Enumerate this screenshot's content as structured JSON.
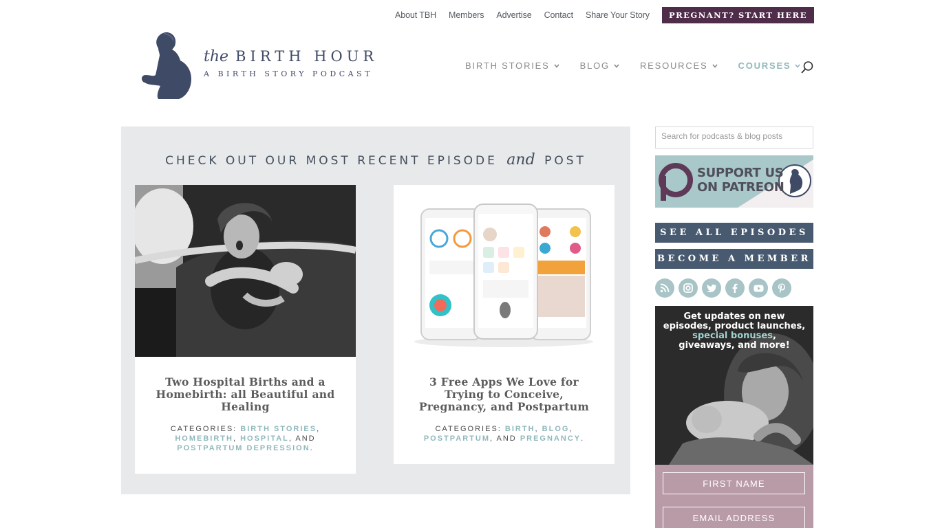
{
  "topnav": {
    "links": [
      "About TBH",
      "Members",
      "Advertise",
      "Contact",
      "Share Your Story"
    ],
    "cta": "PREGNANT? START HERE"
  },
  "logo": {
    "the": "the",
    "name": "BIRTH HOUR",
    "tagline": "A BIRTH STORY PODCAST"
  },
  "mainnav": {
    "items": [
      "BIRTH STORIES",
      "BLOG",
      "RESOURCES",
      "COURSES"
    ],
    "active": "COURSES",
    "search_icon": "search-icon"
  },
  "panel": {
    "heading_before": "CHECK OUT OUR MOST RECENT EPISODE",
    "heading_script": "and",
    "heading_after": "POST"
  },
  "cards": [
    {
      "title": "Two Hospital Births and a Homebirth: all Beautiful and Healing",
      "cats_prefix": "CATEGORIES:",
      "categories": [
        "BIRTH STORIES",
        "HOMEBIRTH",
        "HOSPITAL",
        "POSTPARTUM DEPRESSION"
      ]
    },
    {
      "title": "3 Free Apps We Love for Trying to Conceive, Pregnancy, and Postpartum",
      "cats_prefix": "CATEGORIES:",
      "categories": [
        "BIRTH",
        "BLOG",
        "POSTPARTUM",
        "PREGNANCY"
      ]
    }
  ],
  "sidebar": {
    "search_placeholder": "Search for podcasts & blog posts",
    "patreon_line1": "SUPPORT US",
    "patreon_line2": "ON PATREON",
    "see_all": "SEE ALL EPISODES",
    "become_member": "BECOME A MEMBER",
    "social_icons": [
      "rss-icon",
      "instagram-icon",
      "twitter-icon",
      "facebook-icon",
      "youtube-icon",
      "pinterest-icon"
    ],
    "promo_line1": "Get updates on new",
    "promo_line2": "episodes, product launches,",
    "promo_highlight": "special bonuses",
    "promo_line3_end": ",",
    "promo_line4": "giveaways, and more!",
    "first_name_placeholder": "FIRST NAME",
    "email_placeholder": "EMAIL ADDRESS"
  },
  "colors": {
    "cta_bg": "#4f2d4a",
    "accent_teal": "#8fb8bb",
    "button_slate": "#485a70",
    "panel_bg": "#e8e9ea",
    "promo_bg": "#b99aa7",
    "logo_navy": "#3f4a66"
  }
}
